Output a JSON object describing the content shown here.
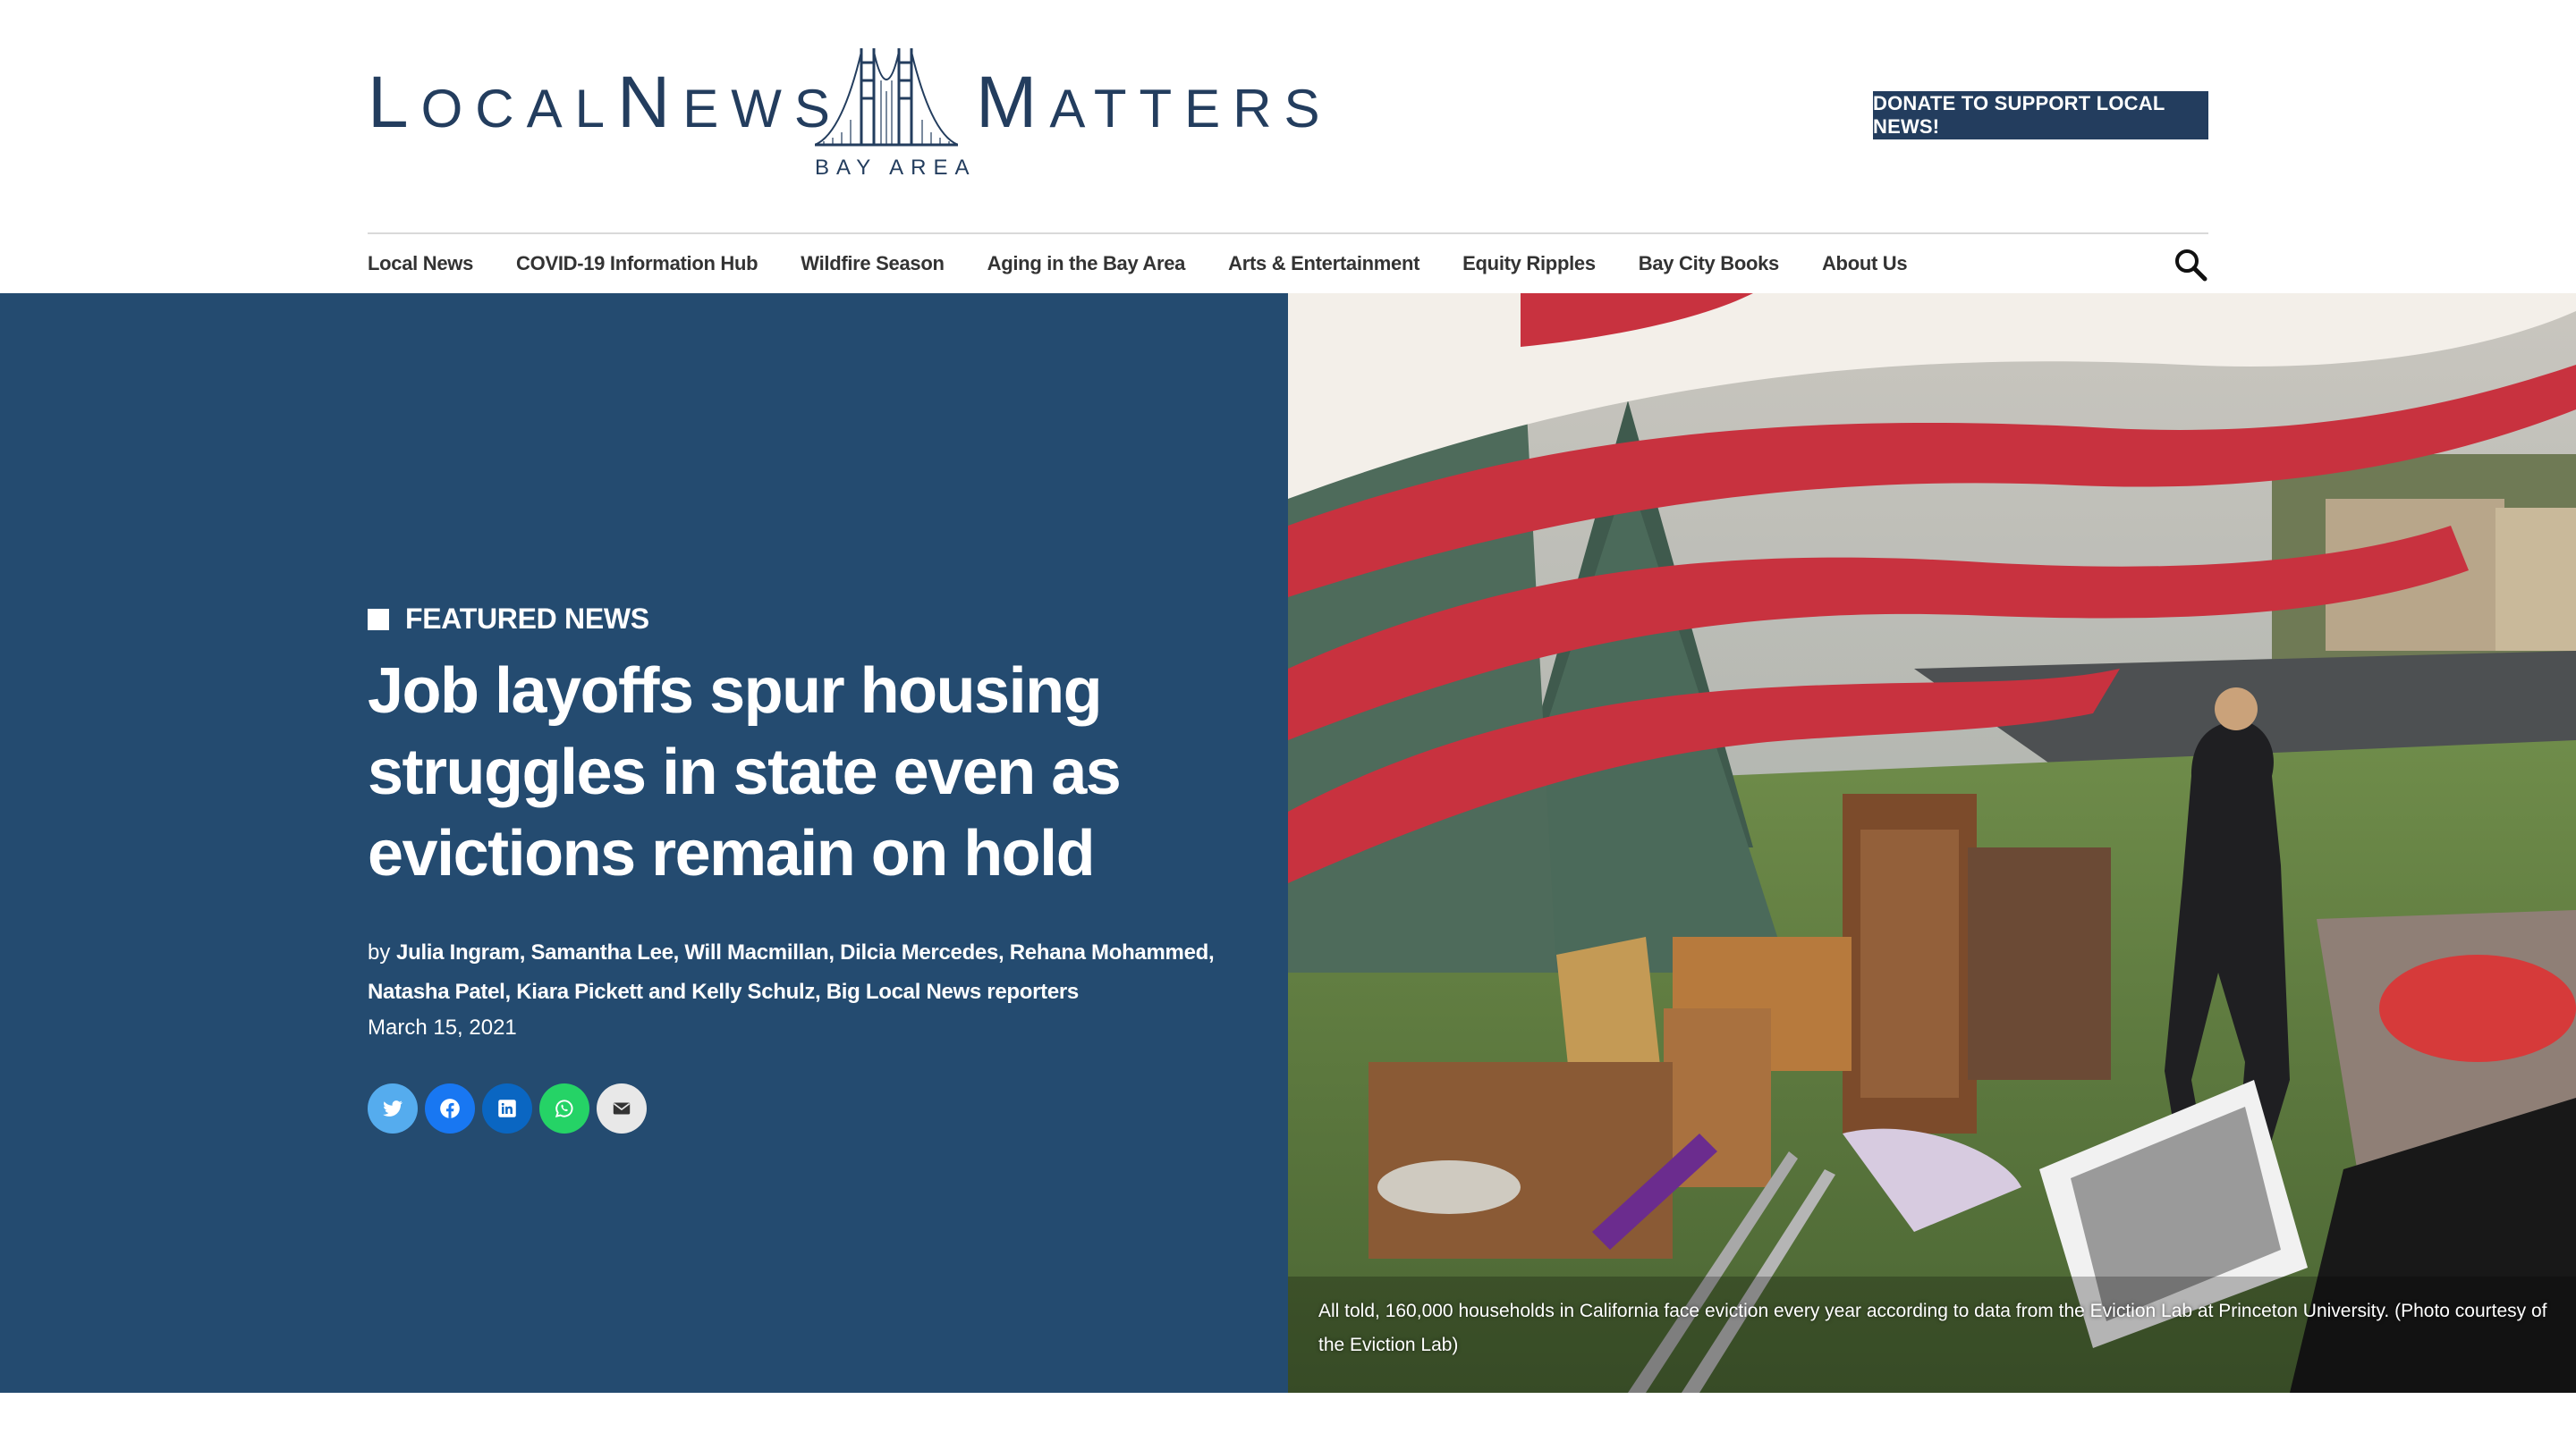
{
  "header": {
    "logo": {
      "word_local": "Local",
      "word_news": "News",
      "word_matters": "Matters",
      "sub": "BAY AREA"
    },
    "donate_label": "DONATE TO SUPPORT LOCAL NEWS!",
    "search_icon": "magnifier-icon"
  },
  "nav": {
    "items": [
      {
        "label": "Local News"
      },
      {
        "label": "COVID-19 Information Hub"
      },
      {
        "label": "Wildfire Season"
      },
      {
        "label": "Aging in the Bay Area"
      },
      {
        "label": "Arts & Entertainment"
      },
      {
        "label": "Equity Ripples"
      },
      {
        "label": "Bay City Books"
      },
      {
        "label": "About Us"
      }
    ]
  },
  "article": {
    "kicker": "FEATURED NEWS",
    "headline": "Job layoffs spur housing struggles in state even as evictions remain on hold",
    "by_prefix": "by",
    "authors": "Julia Ingram, Samantha Lee, Will Macmillan, Dilcia Mercedes, Rehana Mohammed, Natasha Patel, Kiara Pickett and Kelly Schulz, Big Local News reporters",
    "date": "March 15, 2021",
    "share": [
      {
        "name": "twitter-icon",
        "color": "#55acee"
      },
      {
        "name": "facebook-icon",
        "color": "#1877f2"
      },
      {
        "name": "linkedin-icon",
        "color": "#0a66c2"
      },
      {
        "name": "whatsapp-icon",
        "color": "#25d366"
      },
      {
        "name": "email-icon",
        "color": "#e8e8e8"
      }
    ],
    "caption": "All told, 160,000 households in California face eviction every year according to data from the Eviction Lab at Princeton University. (Photo courtesy of the Eviction Lab)"
  },
  "colors": {
    "brand_navy": "#233d5e",
    "hero_blue": "#244b70"
  }
}
